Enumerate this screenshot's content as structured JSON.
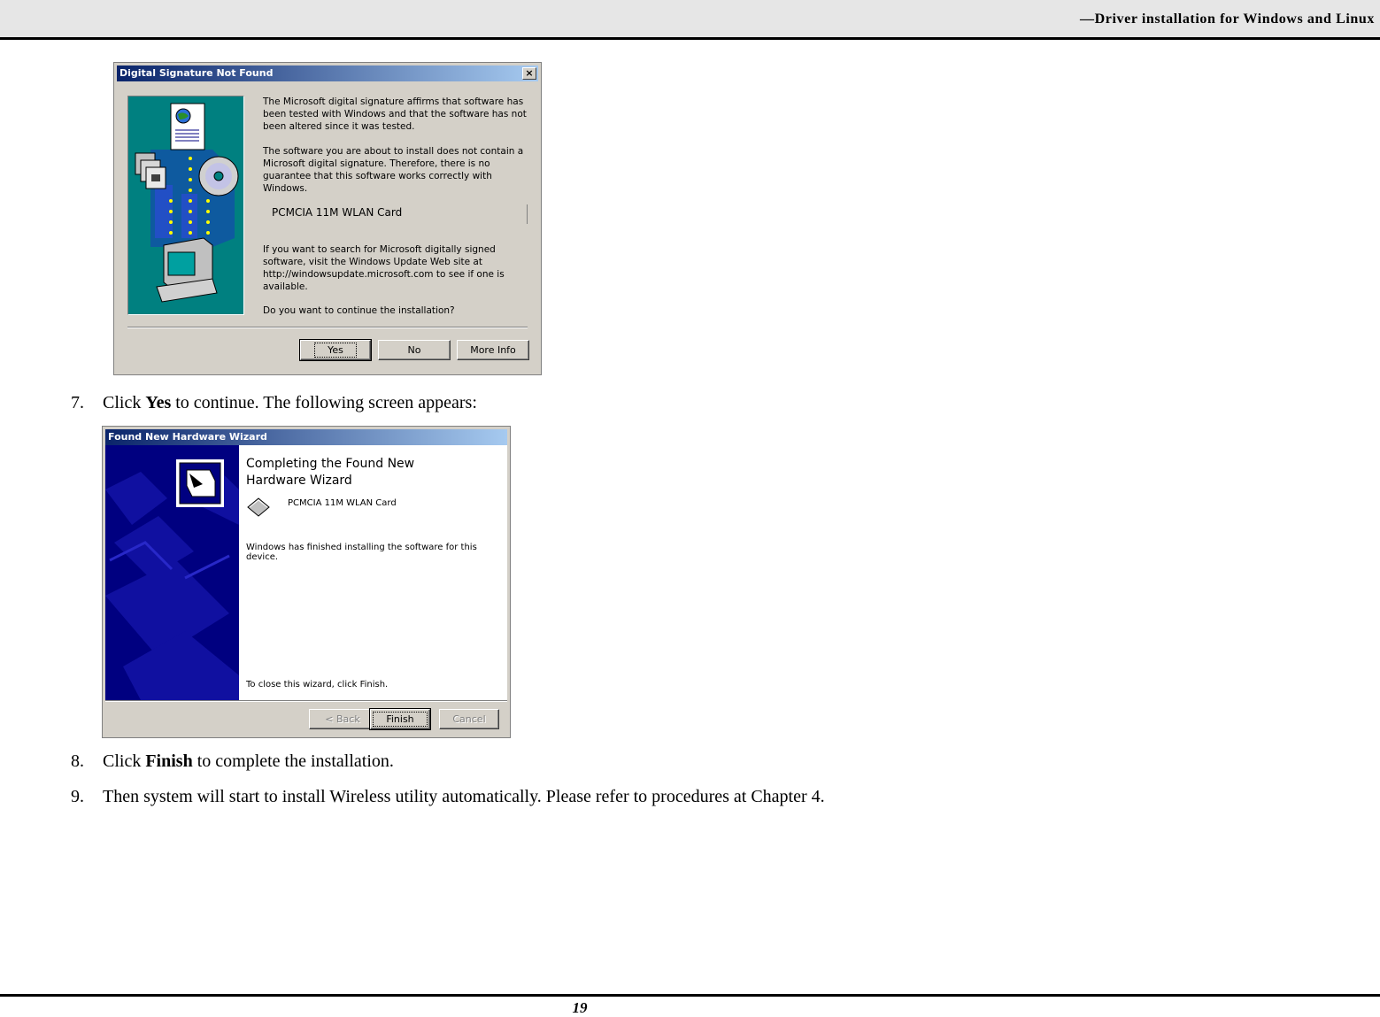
{
  "header": {
    "title": "—Driver installation for Windows and Linux"
  },
  "dialog_signature": {
    "title": "Digital Signature Not Found",
    "close_glyph": "×",
    "paragraph1": "The Microsoft digital signature affirms that software has been tested with Windows and that the software has not been altered since it was tested.",
    "paragraph2": "The software you are about to install does not contain a Microsoft digital signature. Therefore,  there is no guarantee that this software works correctly with Windows.",
    "device_name": "PCMCIA 11M WLAN Card",
    "paragraph3": "If you want to search for Microsoft digitally signed software, visit the Windows Update Web site at http://windowsupdate.microsoft.com to see if one is available.",
    "question": "Do you want to continue the installation?",
    "buttons": {
      "yes": "Yes",
      "no": "No",
      "more_info": "More Info"
    }
  },
  "step7": {
    "number": "7.",
    "prefix": "Click ",
    "bold": "Yes",
    "suffix": " to continue. The following screen appears:"
  },
  "dialog_wizard": {
    "title": "Found New Hardware Wizard",
    "heading": "Completing the Found New Hardware Wizard",
    "device_name": "PCMCIA 11M WLAN Card",
    "finished_text": "Windows has finished installing the software for this device.",
    "close_text": "To close this wizard, click Finish.",
    "buttons": {
      "back": "< Back",
      "finish": "Finish",
      "cancel": "Cancel"
    }
  },
  "step8": {
    "number": "8.",
    "prefix": "Click ",
    "bold": "Finish",
    "suffix": " to complete the installation."
  },
  "step9": {
    "number": "9.",
    "text": "Then system will start to install Wireless utility automatically. Please refer to procedures at Chapter 4."
  },
  "footer": {
    "page_number": "19"
  }
}
